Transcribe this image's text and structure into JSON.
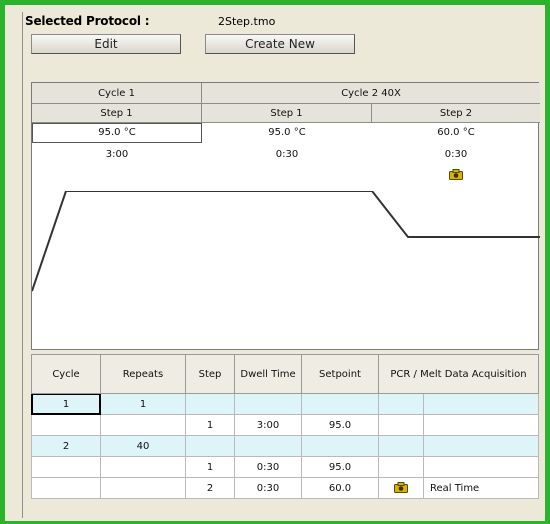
{
  "header": {
    "label": "Selected Protocol :",
    "filename": "2Step.tmo"
  },
  "buttons": {
    "edit": "Edit",
    "create_new": "Create New"
  },
  "protocol": {
    "cycles": [
      {
        "label": "Cycle 1"
      },
      {
        "label": "Cycle 2 40X"
      }
    ],
    "steps": [
      {
        "label": "Step 1",
        "temp": "95.0 °C",
        "time": "3:00",
        "camera": false
      },
      {
        "label": "Step 1",
        "temp": "95.0 °C",
        "time": "0:30",
        "camera": false
      },
      {
        "label": "Step 2",
        "temp": "60.0 °C",
        "time": "0:30",
        "camera": true
      }
    ]
  },
  "table": {
    "headers": [
      "Cycle",
      "Repeats",
      "Step",
      "Dwell Time",
      "Setpoint",
      "PCR / Melt Data Acquisition"
    ],
    "rows": [
      {
        "type": "cycle",
        "cycle": "1",
        "repeats": "1",
        "step": "",
        "dwell": "",
        "setpoint": "",
        "acq": ""
      },
      {
        "type": "step",
        "cycle": "",
        "repeats": "",
        "step": "1",
        "dwell": "3:00",
        "setpoint": "95.0",
        "acq": ""
      },
      {
        "type": "cycle",
        "cycle": "2",
        "repeats": "40",
        "step": "",
        "dwell": "",
        "setpoint": "",
        "acq": ""
      },
      {
        "type": "step",
        "cycle": "",
        "repeats": "",
        "step": "1",
        "dwell": "0:30",
        "setpoint": "95.0",
        "acq": ""
      },
      {
        "type": "step",
        "cycle": "",
        "repeats": "",
        "step": "2",
        "dwell": "0:30",
        "setpoint": "60.0",
        "acq": "Real Time"
      }
    ]
  },
  "colors": {
    "frame": "#2bb42b",
    "cycle_row": "#ddf4f8",
    "camera": "#c8a000"
  },
  "icons": {
    "camera": "camera-icon"
  }
}
